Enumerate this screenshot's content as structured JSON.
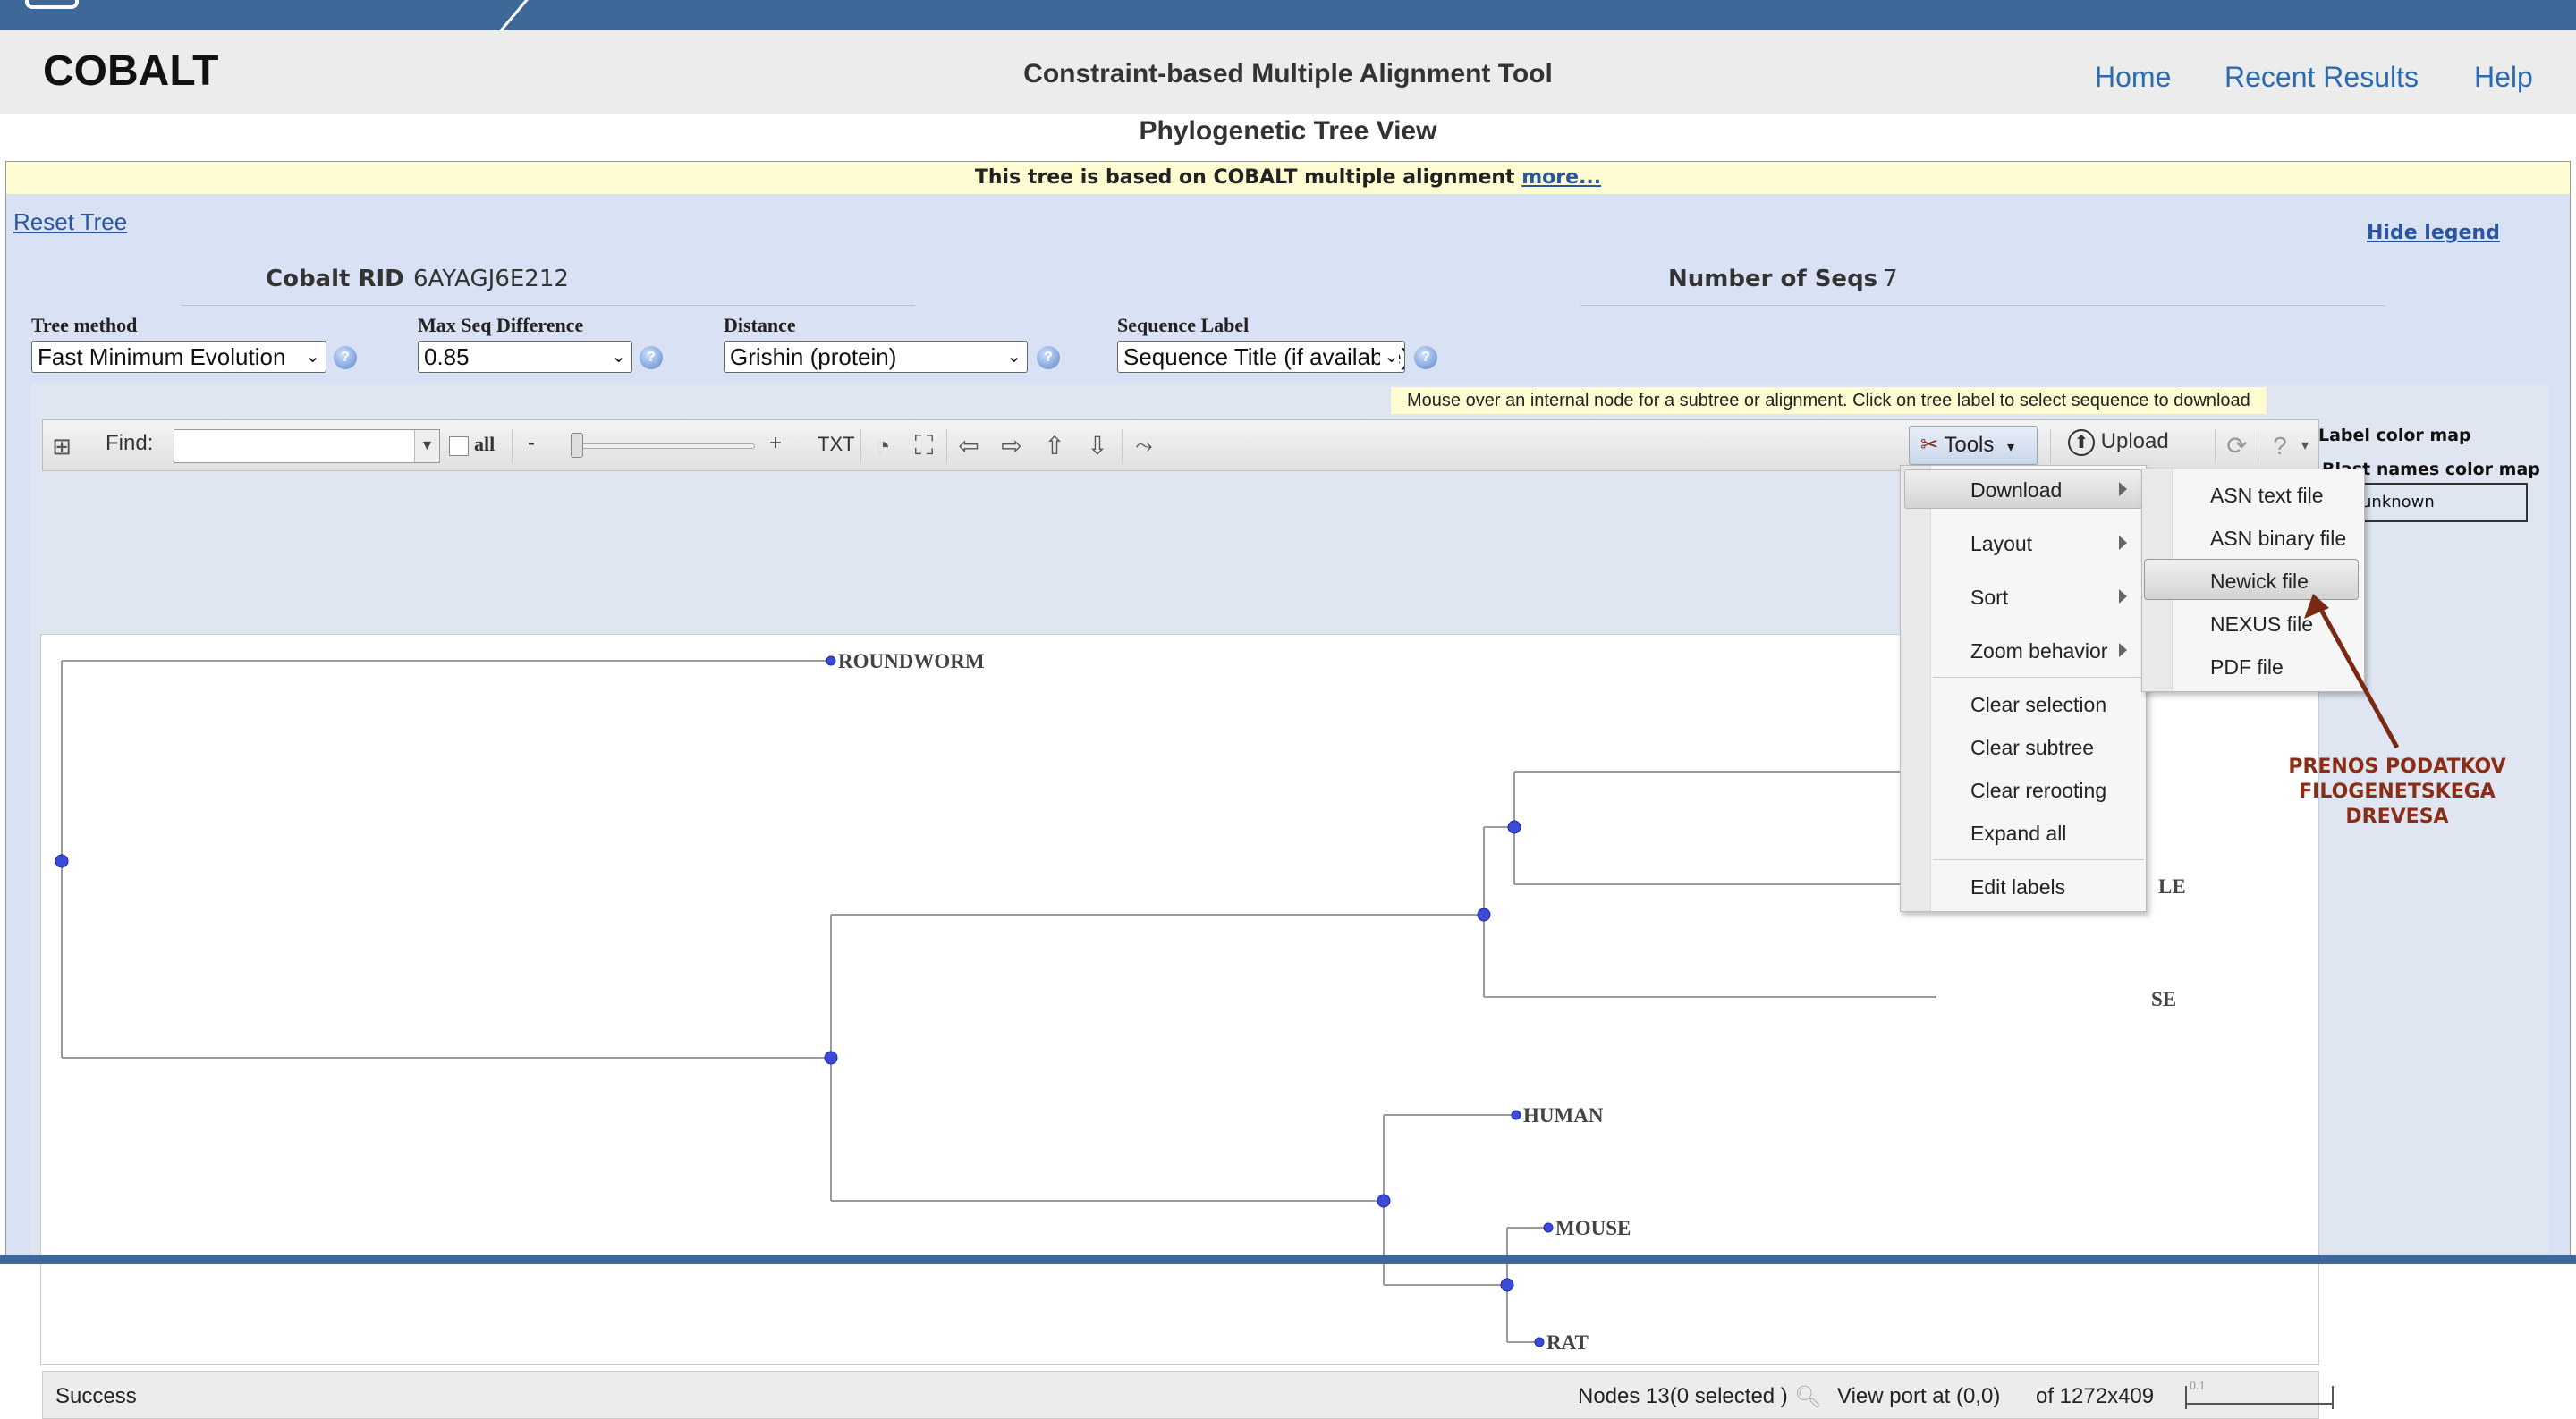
{
  "header": {
    "brand": "COBALT",
    "tool_title": "Constraint-based Multiple Alignment Tool",
    "nav": [
      "Home",
      "Recent Results",
      "Help"
    ]
  },
  "page_title": "Phylogenetic Tree View",
  "notice": {
    "text": "This tree is based on COBALT multiple alignment",
    "link": "more..."
  },
  "reset_tree": "Reset Tree",
  "info": {
    "rid_label": "Cobalt RID",
    "rid_value": "6AYAGJ6E212",
    "seqs_label": "Number of Seqs",
    "seqs_value": "7"
  },
  "options": {
    "tree_method": {
      "label": "Tree method",
      "value": "Fast Minimum Evolution"
    },
    "max_seq_diff": {
      "label": "Max Seq Difference",
      "value": "0.85"
    },
    "distance": {
      "label": "Distance",
      "value": "Grishin (protein)"
    },
    "sequence_label": {
      "label": "Sequence Label",
      "value": "Sequence Title (if available)"
    }
  },
  "viewer": {
    "hint": "Mouse over an internal node for a subtree or alignment. Click on tree label to select sequence to download",
    "hide_legend": "Hide legend",
    "toolbar": {
      "find_label": "Find:",
      "find_value": "",
      "all_label": "all",
      "zoom_minus": "-",
      "zoom_plus": "+",
      "txt": "TXT",
      "tools": "Tools",
      "upload": "Upload"
    },
    "tree_labels": {
      "roundworm": "ROUNDWORM",
      "le": "LE",
      "se": "SE",
      "human": "HUMAN",
      "mouse": "MOUSE",
      "rat": "RAT"
    },
    "status": {
      "message": "Success",
      "nodes": "Nodes 13(0 selected )",
      "viewport": "View port at (0,0)",
      "size": "of 1272x409",
      "scale": "0.1"
    }
  },
  "tools_menu": {
    "items": [
      {
        "label": "Download",
        "submenu": true
      },
      {
        "label": "Layout",
        "submenu": true
      },
      {
        "label": "Sort",
        "submenu": true
      },
      {
        "label": "Zoom behavior",
        "submenu": true
      },
      {
        "label": "Clear selection"
      },
      {
        "label": "Clear subtree"
      },
      {
        "label": "Clear rerooting"
      },
      {
        "label": "Expand all"
      },
      {
        "label": "Edit labels"
      }
    ]
  },
  "download_submenu": {
    "items": [
      "ASN text file",
      "ASN binary file",
      "Newick file",
      "NEXUS file",
      "PDF file"
    ],
    "highlighted": "Newick file"
  },
  "legend": {
    "label_color_map": "Label color map",
    "blast_names_color_map": "Blast names color map",
    "unknown": "unknown"
  },
  "annotation": {
    "line1": "PRENOS PODATKOV",
    "line2": "FILOGENETSKEGA",
    "line3": "DREVESA",
    "color": "#8a2d16"
  },
  "colors": {
    "topbar": "#3d6898",
    "link": "#2a6bb3",
    "node": "#3b4bd8"
  }
}
